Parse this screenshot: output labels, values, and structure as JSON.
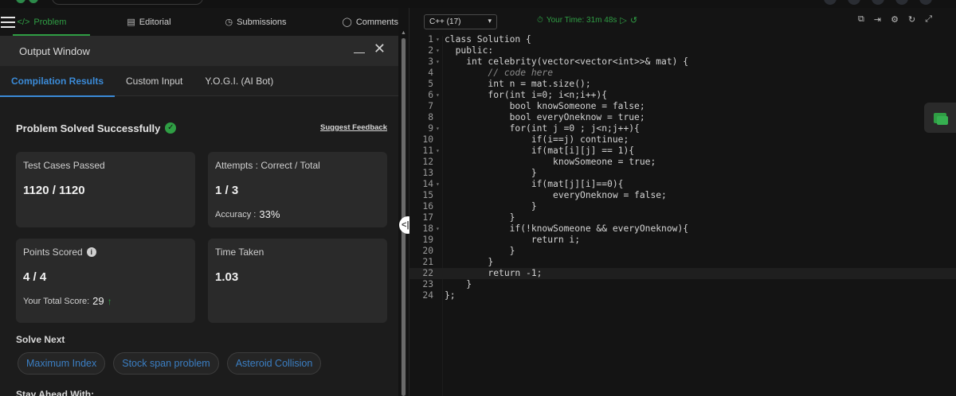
{
  "nav": {
    "tabs": [
      {
        "label": "Problem",
        "icon": "code-icon"
      },
      {
        "label": "Editorial",
        "icon": "document-icon"
      },
      {
        "label": "Submissions",
        "icon": "clock-icon"
      },
      {
        "label": "Comments",
        "icon": "chat-icon"
      }
    ]
  },
  "output": {
    "title": "Output Window",
    "subtabs": [
      "Compilation Results",
      "Custom Input",
      "Y.O.G.I. (AI Bot)"
    ],
    "status": "Problem Solved Successfully",
    "feedback": "Suggest Feedback",
    "cards": {
      "test_cases": {
        "label": "Test Cases Passed",
        "value": "1120 / 1120"
      },
      "attempts": {
        "label": "Attempts : Correct / Total",
        "value": "1 / 3",
        "sub_label": "Accuracy :",
        "sub_value": "33%"
      },
      "points": {
        "label": "Points Scored",
        "value": "4 / 4",
        "sub_label": "Your Total Score:",
        "sub_value": "29"
      },
      "time": {
        "label": "Time Taken",
        "value": "1.03"
      }
    },
    "solve_next": "Solve Next",
    "suggestions": [
      "Maximum Index",
      "Stock span problem",
      "Asteroid Collision"
    ],
    "stay_ahead": "Stay Ahead With:"
  },
  "editor": {
    "language": "C++ (17)",
    "timer": "Your Time: 31m 48s",
    "lines": [
      "class Solution {",
      "  public:",
      "    int celebrity(vector<vector<int>>& mat) {",
      "        // code here",
      "        int n = mat.size();",
      "        for(int i=0; i<n;i++){",
      "            bool knowSomeone = false;",
      "            bool everyOneknow = true;",
      "            for(int j =0 ; j<n;j++){",
      "                if(i==j) continue;",
      "                if(mat[i][j] == 1){",
      "                    knowSomeone = true;",
      "                }",
      "                if(mat[j][i]==0){",
      "                    everyOneknow = false;",
      "                }",
      "            }",
      "            if(!knowSomeone && everyOneknow){",
      "                return i;",
      "            }",
      "        }",
      "        return -1;",
      "    }",
      "};"
    ],
    "highlighted_line": 22
  },
  "colors": {
    "accent": "#2f9e44",
    "link": "#3b8bd8"
  }
}
